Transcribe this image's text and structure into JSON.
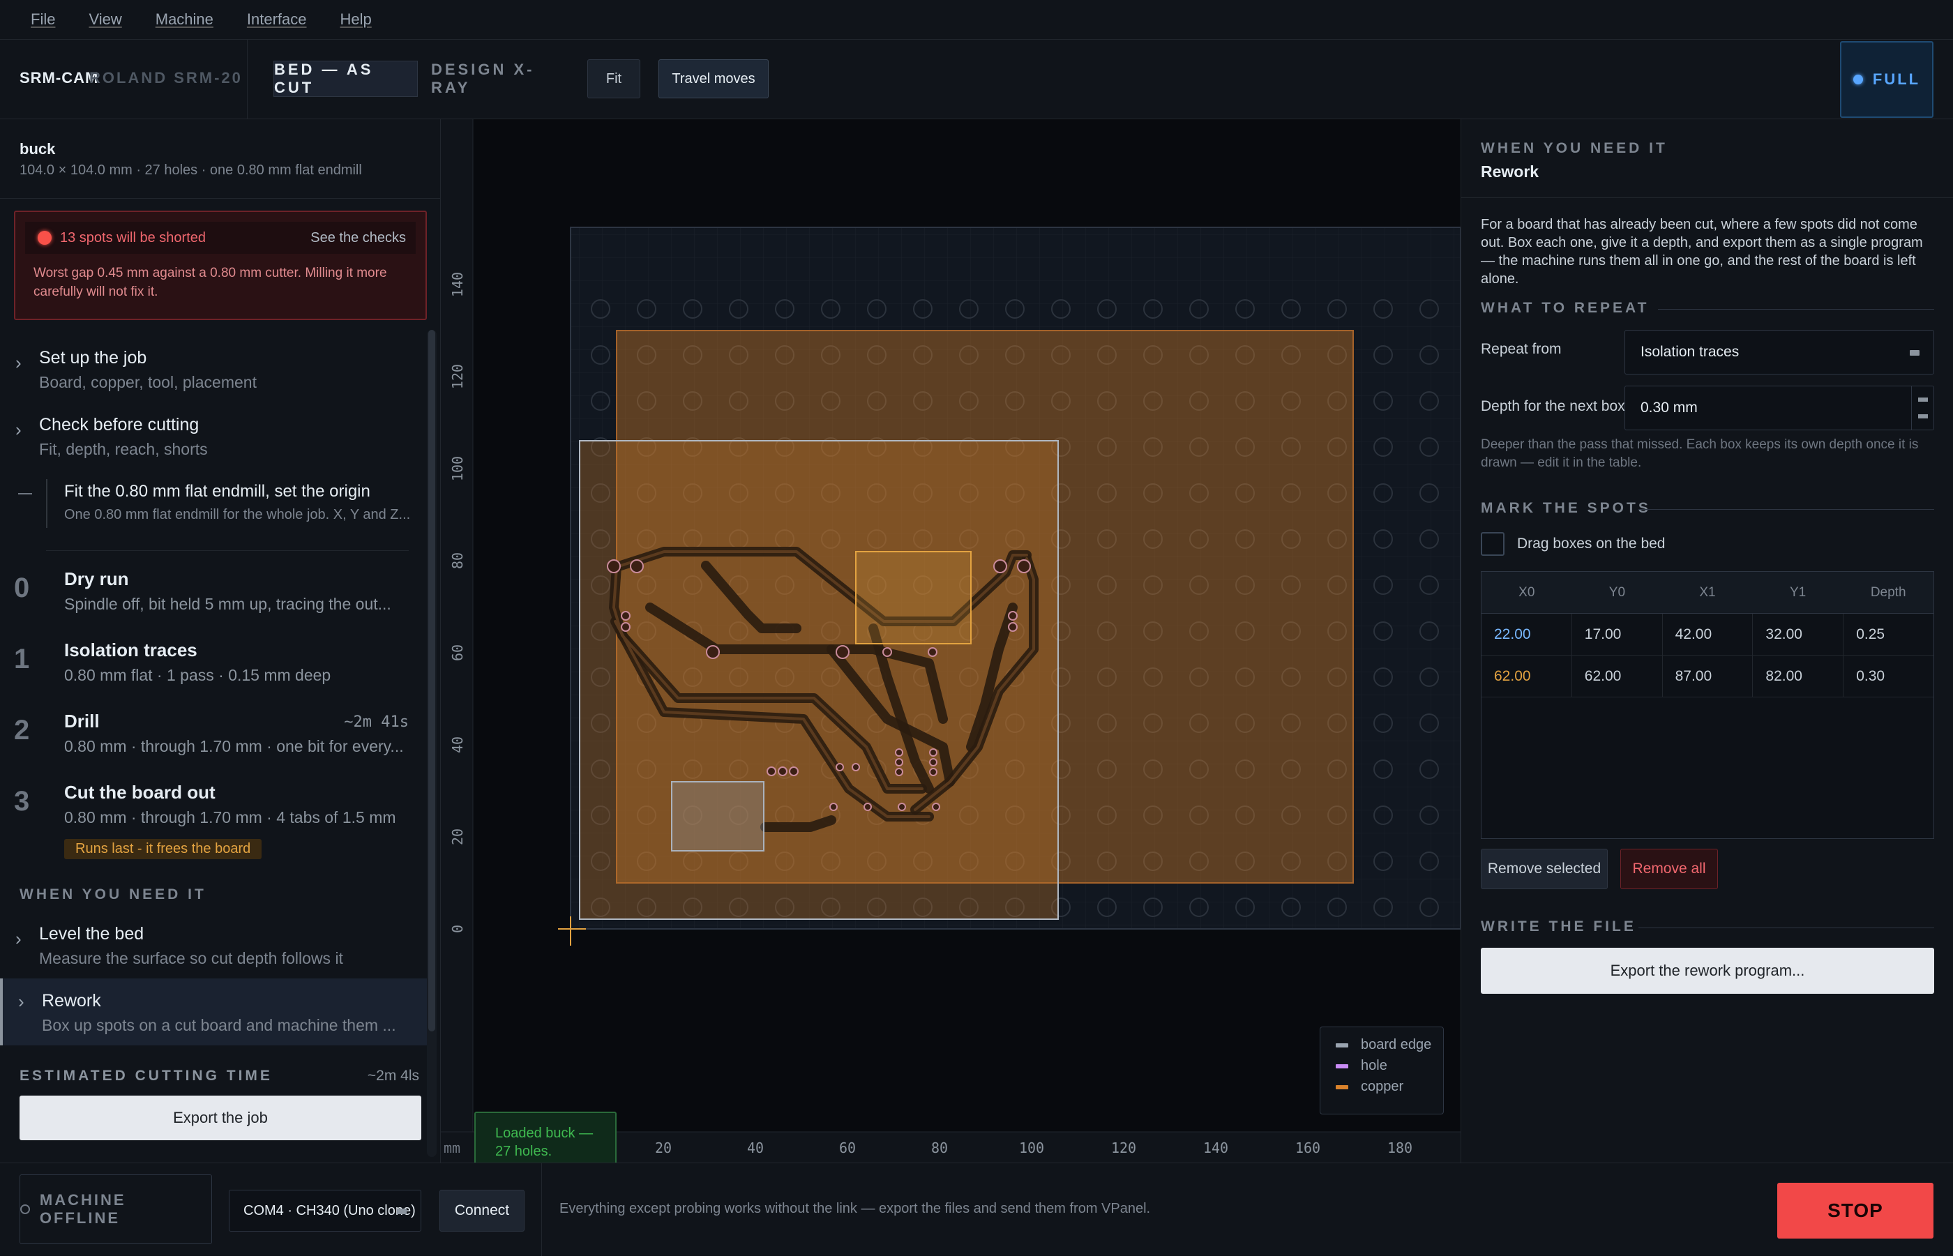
{
  "menu": {
    "items": [
      "File",
      "View",
      "Machine",
      "Interface",
      "Help"
    ]
  },
  "toolbar": {
    "brand": "SRM-CAM",
    "machine": "ROLAND SRM-20",
    "view_bed": "BED — AS CUT",
    "view_xray": "DESIGN X-RAY",
    "fit": "Fit",
    "travel": "Travel moves",
    "full": "FULL"
  },
  "job": {
    "name": "buck",
    "meta": "104.0 × 104.0 mm · 27 holes · one 0.80 mm flat endmill"
  },
  "warning": {
    "title": "13 spots will be shorted",
    "link": "See the checks",
    "body": "Worst gap 0.45 mm against a 0.80 mm cutter. Milling it more carefully will not fix it."
  },
  "nav": {
    "setup": {
      "title": "Set up the job",
      "sub": "Board, copper, tool, placement"
    },
    "check": {
      "title": "Check before cutting",
      "sub": "Fit, depth, reach, shorts"
    },
    "fit_tool": {
      "title": "Fit the 0.80 mm flat endmill, set the origin",
      "sub": "One 0.80 mm flat endmill for the whole job. X, Y and Z..."
    }
  },
  "steps": [
    {
      "num": "0",
      "title": "Dry run",
      "sub": "Spindle off, bit held 5 mm up, tracing the out...",
      "time": ""
    },
    {
      "num": "1",
      "title": "Isolation traces",
      "sub": "0.80 mm flat · 1 pass · 0.15 mm deep",
      "time": ""
    },
    {
      "num": "2",
      "title": "Drill",
      "sub": "0.80 mm · through 1.70 mm · one bit for every...",
      "time": "~2m 41s"
    },
    {
      "num": "3",
      "title": "Cut the board out",
      "sub": "0.80 mm · through 1.70 mm · 4 tabs of 1.5 mm",
      "time": "",
      "tag": "Runs last - it frees the board"
    }
  ],
  "when_needed": {
    "heading": "WHEN YOU NEED IT",
    "level": {
      "title": "Level the bed",
      "sub": "Measure the surface so cut depth follows it"
    },
    "rework": {
      "title": "Rework",
      "sub": "Box up spots on a cut board and machine them ..."
    }
  },
  "estimate": {
    "label": "ESTIMATED CUTTING TIME",
    "value": "~2m 4ls",
    "export": "Export the job"
  },
  "canvas": {
    "unit": "mm",
    "x_ticks": [
      "20",
      "40",
      "60",
      "80",
      "100",
      "120",
      "140",
      "160",
      "180"
    ],
    "y_ticks": [
      "0",
      "20",
      "40",
      "60",
      "80",
      "100",
      "120",
      "140"
    ],
    "legend": [
      {
        "label": "board edge",
        "color": "#9aa4b0"
      },
      {
        "label": "hole",
        "color": "#c98bf5"
      },
      {
        "label": "copper",
        "color": "#d9822b"
      }
    ],
    "toast": "Loaded buck — 27 holes."
  },
  "right": {
    "kicker": "WHEN YOU NEED IT",
    "title": "Rework",
    "desc": "For a board that has already been cut, where a few spots did not come out. Box each one, give it a depth, and export them as a single program — the machine runs them all in one go, and the rest of the board is left alone.",
    "repeat_head": "WHAT TO REPEAT",
    "repeat_label": "Repeat from",
    "repeat_value": "Isolation traces",
    "depth_label": "Depth for the next box",
    "depth_value": "0.30 mm",
    "hint": "Deeper than the pass that missed. Each box keeps its own depth once it is drawn — edit it in the table.",
    "mark_head": "MARK THE SPOTS",
    "drag_label": "Drag boxes on the bed",
    "columns": [
      "X0",
      "Y0",
      "X1",
      "Y1",
      "Depth"
    ],
    "rows": [
      {
        "x0": "22.00",
        "y0": "17.00",
        "x1": "42.00",
        "y1": "32.00",
        "depth": "0.25",
        "color": "#79b8ff"
      },
      {
        "x0": "62.00",
        "y0": "62.00",
        "x1": "87.00",
        "y1": "82.00",
        "depth": "0.30",
        "color": "#e3a341"
      }
    ],
    "remove_selected": "Remove selected",
    "remove_all": "Remove all",
    "write_head": "WRITE THE FILE",
    "export": "Export the rework program..."
  },
  "bottom": {
    "offline": "MACHINE OFFLINE",
    "port": "COM4 · CH340 (Uno clone)",
    "connect": "Connect",
    "note": "Everything except probing works without the link — export the files and send them from VPanel.",
    "stop": "STOP"
  }
}
